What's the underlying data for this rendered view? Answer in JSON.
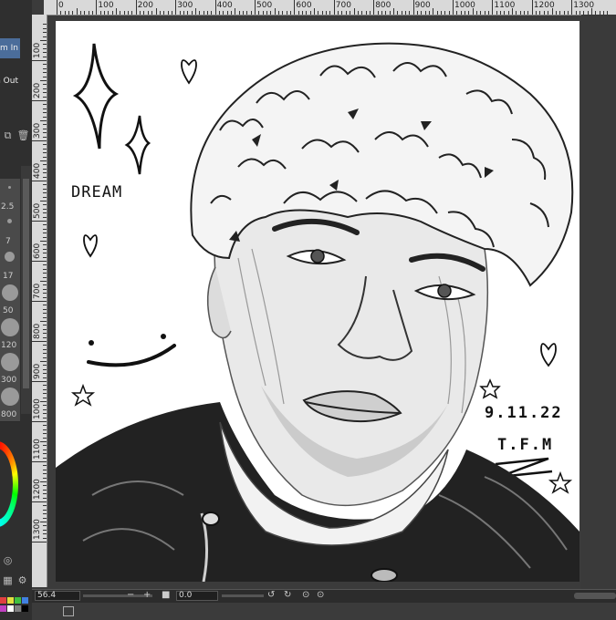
{
  "navigator": {
    "zoom_in_label": "om In",
    "zoom_out_label": "n Out"
  },
  "brush_sizes": [
    "2.5",
    "7",
    "17",
    "50",
    "120",
    "300",
    "800"
  ],
  "ruler": {
    "top_labels": [
      "0",
      "100",
      "200",
      "300",
      "400",
      "500",
      "600",
      "700",
      "800",
      "900",
      "1000",
      "1100",
      "1200",
      "1300"
    ],
    "left_labels": [
      "100",
      "200",
      "300",
      "400",
      "500",
      "600",
      "700",
      "800",
      "900",
      "1000",
      "1100",
      "1200",
      "1300"
    ]
  },
  "drawing": {
    "text_dream": "DREAM",
    "date": "9.11.22",
    "initials": "T.F.M"
  },
  "bottom_bar": {
    "zoom_value": "56.4",
    "angle_value": "0.0"
  },
  "icons": {
    "duplicate": "duplicate-icon",
    "trash": "trash-icon",
    "status": "window-icon"
  },
  "palette": [
    "#e04040",
    "#e0e040",
    "#40c040",
    "#4080e0",
    "#c040c0",
    "#ffffff",
    "#808080",
    "#000000"
  ]
}
